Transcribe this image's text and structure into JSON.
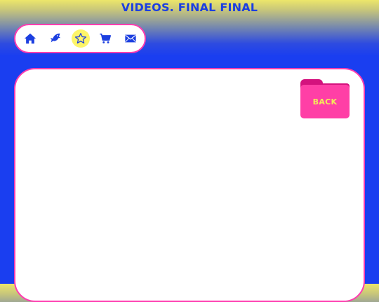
{
  "header": {
    "title": "VIDEOS. FINAL FINAL"
  },
  "nav": {
    "items": [
      {
        "icon": "home-icon",
        "active": false
      },
      {
        "icon": "fish-icon",
        "active": false
      },
      {
        "icon": "star-icon",
        "active": true
      },
      {
        "icon": "cart-icon",
        "active": false
      },
      {
        "icon": "mail-icon",
        "active": false
      }
    ]
  },
  "folder": {
    "label": "BACK"
  },
  "colors": {
    "accent_pink": "#ff3db0",
    "folder_pink": "#ff3fa6",
    "folder_dark": "#d4127e",
    "nav_blue": "#1c3fe0",
    "highlight_yellow": "#fdf56a",
    "background_blue": "#1a3ef0",
    "label_yellow": "#f5ea5a"
  }
}
